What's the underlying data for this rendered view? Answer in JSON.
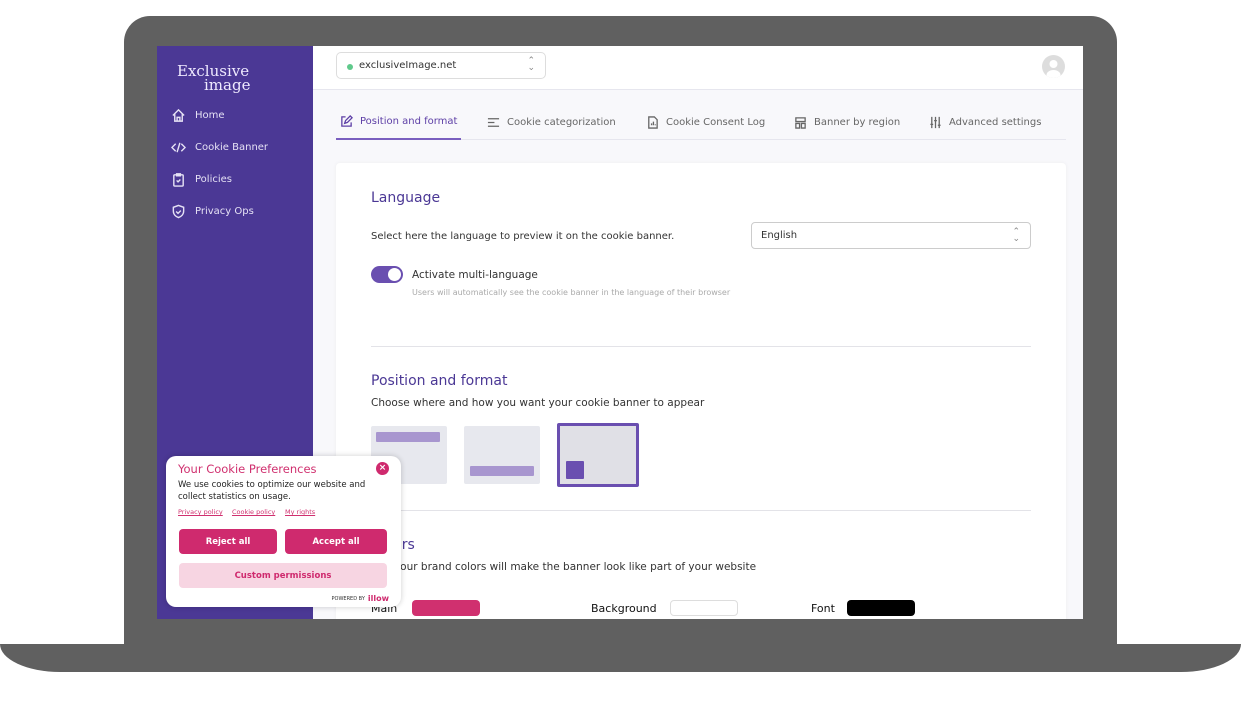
{
  "brand": {
    "logo_line1": "Exclusive",
    "logo_line2": "image"
  },
  "sidebar": {
    "items": [
      {
        "label": "Home",
        "icon": "home-icon"
      },
      {
        "label": "Cookie Banner",
        "icon": "code-icon"
      },
      {
        "label": "Policies",
        "icon": "clipboard-check-icon"
      },
      {
        "label": "Privacy Ops",
        "icon": "shield-check-icon"
      }
    ]
  },
  "header": {
    "site": "exclusiveImage.net",
    "site_status_color": "#5fc98b"
  },
  "tabs": [
    {
      "label": "Position and format",
      "active": true
    },
    {
      "label": "Cookie categorization"
    },
    {
      "label": "Cookie Consent Log"
    },
    {
      "label": "Banner by region"
    },
    {
      "label": "Advanced settings"
    }
  ],
  "language": {
    "title": "Language",
    "desc": "Select here the language to preview it on the cookie banner.",
    "selected": "English",
    "toggle_label": "Activate multi-language",
    "toggle_on": true,
    "toggle_help": "Users will automatically see the cookie banner in the language of their browser"
  },
  "position": {
    "title": "Position and format",
    "desc": "Choose where and how you want your cookie banner to appear",
    "selected_option": 3
  },
  "colors": {
    "title": "Colors",
    "desc": "Use your brand colors will make the banner look like part of your website",
    "main_label": "Main",
    "main": "#d0306f",
    "background_label": "Background",
    "background": "#ffffff",
    "font_label": "Font",
    "font": "#000000"
  },
  "popup": {
    "title": "Your Cookie Preferences",
    "desc": "We use cookies to optimize our website and collect statistics on usage.",
    "links": [
      "Privacy policy",
      "Cookie policy",
      "My rights"
    ],
    "reject": "Reject all",
    "accept": "Accept all",
    "custom": "Custom permissions",
    "powered_by": "POWERED BY",
    "powered_brand": "illow"
  },
  "accent": "#4b3895"
}
